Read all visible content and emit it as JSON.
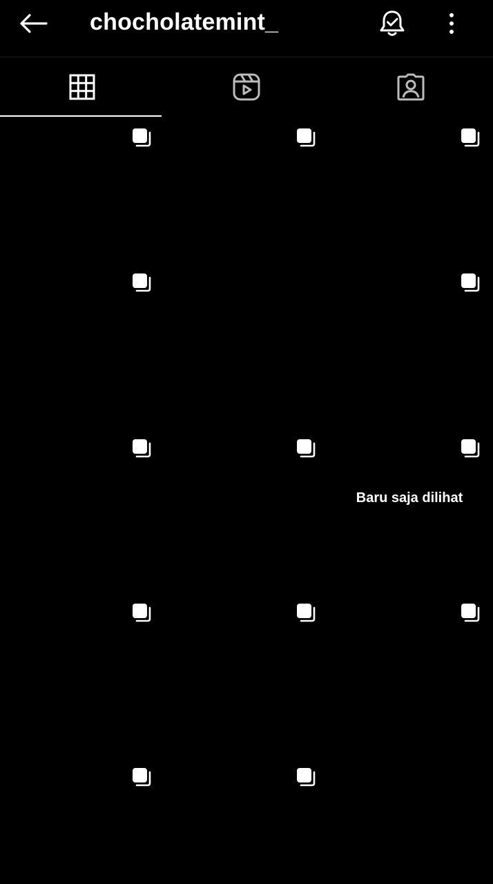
{
  "header": {
    "username": "chocholatemint_",
    "back_icon": "arrow-left-icon",
    "bell_icon": "bell-check-icon",
    "more_icon": "more-vertical-icon"
  },
  "tabs": [
    {
      "name": "posts",
      "icon": "grid-icon",
      "active": true
    },
    {
      "name": "reels",
      "icon": "reels-icon",
      "active": false
    },
    {
      "name": "tagged",
      "icon": "tagged-person-icon",
      "active": false
    }
  ],
  "posts": [
    {
      "id": 1,
      "multi": true,
      "overlay_text": "",
      "colors": [
        "#6b4328",
        "#c9a97f",
        "#1f1a18"
      ]
    },
    {
      "id": 2,
      "multi": true,
      "overlay_text": "",
      "colors": [
        "#b08070",
        "#f2c7b0",
        "#2a4c80"
      ]
    },
    {
      "id": 3,
      "multi": true,
      "overlay_text": "",
      "colors": [
        "#2e3a3a",
        "#6e7a72",
        "#1a1a1a"
      ]
    },
    {
      "id": 4,
      "multi": true,
      "overlay_text": "",
      "colors": [
        "#8fb8d6",
        "#d9e3ea",
        "#c21a33"
      ]
    },
    {
      "id": 5,
      "multi": false,
      "overlay_text": "",
      "colors": [
        "#4e6b3a",
        "#c2c6c4",
        "#2d2e33"
      ]
    },
    {
      "id": 6,
      "multi": true,
      "overlay_text": "",
      "colors": [
        "#6b3a2a",
        "#2f4a26",
        "#1a1818"
      ]
    },
    {
      "id": 7,
      "multi": true,
      "overlay_text": "",
      "colors": [
        "#b7cad6",
        "#5c7c8a",
        "#e0277a"
      ]
    },
    {
      "id": 8,
      "multi": true,
      "overlay_text": "",
      "colors": [
        "#9aa7ad",
        "#6b5a4a",
        "#ee3f8a"
      ]
    },
    {
      "id": 9,
      "multi": true,
      "overlay_text": "Baru saja dilihat",
      "colors": [
        "#2a3030",
        "#3d3a35",
        "#1e2420"
      ]
    },
    {
      "id": 10,
      "multi": true,
      "overlay_text": "",
      "colors": [
        "#a8cde6",
        "#4f7a3a",
        "#c98a5a"
      ]
    },
    {
      "id": 11,
      "multi": true,
      "overlay_text": "",
      "colors": [
        "#3e5a2a",
        "#9c8870",
        "#4a3e38"
      ]
    },
    {
      "id": 12,
      "multi": true,
      "overlay_text": "",
      "colors": [
        "#8ab8d8",
        "#4b6a33",
        "#b59a80"
      ]
    },
    {
      "id": 13,
      "multi": true,
      "overlay_text": "",
      "colors": [
        "#5b7a86",
        "#3a2a26",
        "#c11e2a"
      ]
    },
    {
      "id": 14,
      "multi": true,
      "overlay_text": "",
      "colors": [
        "#2b4a22",
        "#e6e2dc",
        "#1b1b1b"
      ]
    }
  ]
}
